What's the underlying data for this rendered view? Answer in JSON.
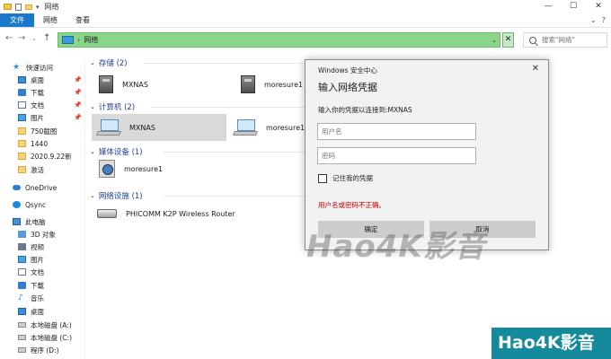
{
  "window": {
    "title": "网络",
    "ctrl_min": "—",
    "ctrl_max": "☐",
    "ctrl_close": "✕"
  },
  "ribbon": {
    "tabs": [
      "文件",
      "网络",
      "查看"
    ],
    "expand": "⌄",
    "help": "?"
  },
  "address": {
    "path_sep": "›",
    "location": "网络",
    "clear": "✕"
  },
  "search": {
    "placeholder": "搜索\"网络\""
  },
  "sidebar": {
    "quick_access": "快速访问",
    "items": [
      {
        "label": "桌面",
        "icon": "desktop-icon",
        "pinned": true
      },
      {
        "label": "下载",
        "icon": "download-icon",
        "pinned": true
      },
      {
        "label": "文档",
        "icon": "document-icon",
        "pinned": true
      },
      {
        "label": "图片",
        "icon": "picture-icon",
        "pinned": true
      },
      {
        "label": "750截图",
        "icon": "folder-icon",
        "pinned": false
      },
      {
        "label": "1440",
        "icon": "folder-icon",
        "pinned": false
      },
      {
        "label": "2020.9.22新",
        "icon": "folder-icon",
        "pinned": false
      },
      {
        "label": "激活",
        "icon": "folder-icon",
        "pinned": false
      }
    ],
    "onedrive": "OneDrive",
    "qsync": "Qsync",
    "this_pc": "此电脑",
    "pc_items": [
      "3D 对象",
      "视频",
      "图片",
      "文档",
      "下载",
      "音乐",
      "桌面",
      "本地磁盘 (A:)",
      "本地磁盘 (C:)",
      "程序 (D:)"
    ]
  },
  "groups": {
    "storage": "存储 (2)",
    "computers": "计算机 (2)",
    "media": "媒体设备 (1)",
    "network": "网络设施 (1)"
  },
  "items": {
    "storage_1": "MXNAS",
    "storage_2": "moresure1",
    "computer_1": "MXNAS",
    "computer_2": "moresure1",
    "media_1": "moresure1",
    "router_1": "PHICOMM K2P Wireless Router"
  },
  "dialog": {
    "caption": "Windows 安全中心",
    "heading": "输入网络凭据",
    "subtitle": "输入你的凭据以连接到:MXNAS",
    "username_placeholder": "用户名",
    "password_placeholder": "密码",
    "remember": "记住我的凭据",
    "error": "用户名或密码不正确。",
    "ok": "确定",
    "cancel": "取消",
    "close": "✕"
  },
  "watermark": {
    "center": "Hao4K影音",
    "corner": "Hao4K影音"
  }
}
